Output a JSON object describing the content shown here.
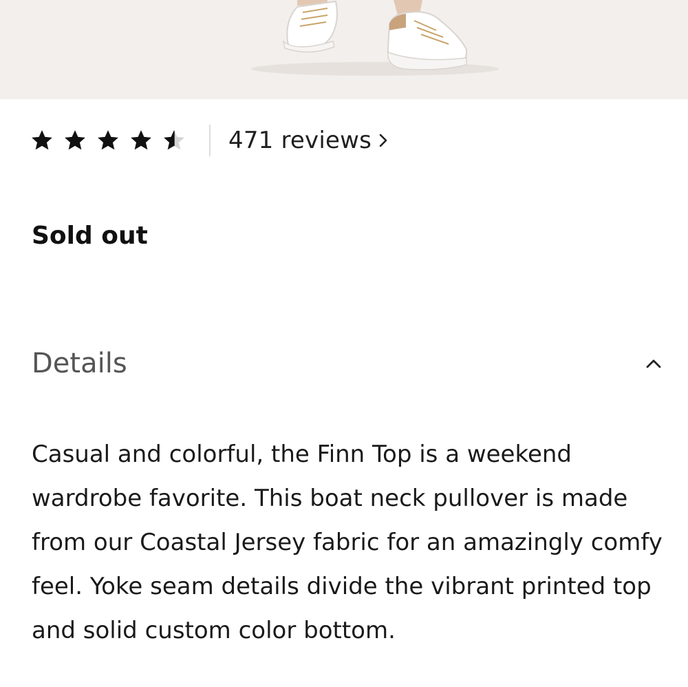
{
  "product_image": {
    "alt": "",
    "background_color": "#f2efec"
  },
  "rating": {
    "value": 4.5,
    "max": 5,
    "reviews_label": "471 reviews",
    "reviews_chevron": "chevron-right-icon"
  },
  "availability": {
    "status": "Sold out"
  },
  "details": {
    "title": "Details",
    "toggle_icon": "chevron-up-icon",
    "expanded": true,
    "description": "Casual and colorful, the Finn Top is a weekend wardrobe favorite. This boat neck pullover is made from our Coastal Jersey fabric for an amazingly comfy feel. Yoke seam details divide the vibrant printed top and solid custom color bottom."
  }
}
